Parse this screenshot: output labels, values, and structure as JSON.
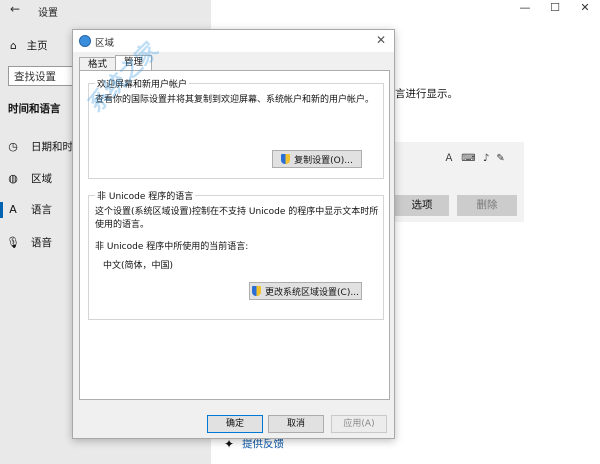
{
  "settings": {
    "title": "设置",
    "back_icon": "back-arrow-icon",
    "home_label": "主页",
    "search_placeholder": "查找设置",
    "section_heading": "时间和语言",
    "nav_items": [
      {
        "label": "日期和时间",
        "icon": "clock-calendar-icon"
      },
      {
        "label": "区域",
        "icon": "globe-icon"
      },
      {
        "label": "语言",
        "icon": "language-icon"
      },
      {
        "label": "语音",
        "icon": "microphone-icon"
      }
    ],
    "window_controls": [
      "—",
      "☐",
      "✕"
    ],
    "bg_text": "言进行显示。",
    "bg_options_button": "选项",
    "bg_delete_button": "删除",
    "feedback_link": "提供反馈"
  },
  "dialog": {
    "title": "区域",
    "tabs": [
      {
        "label": "格式",
        "active": false
      },
      {
        "label": "管理",
        "active": true
      }
    ],
    "welcome_group": {
      "label": "欢迎屏幕和新用户帐户",
      "description": "查看你的国际设置并将其复制到欢迎屏幕、系统帐户和新的用户帐户。",
      "button": "复制设置(O)..."
    },
    "unicode_group": {
      "label": "非 Unicode 程序的语言",
      "description": "这个设置(系统区域设置)控制在不支持 Unicode 的程序中显示文本时所使用的语言。",
      "current_label": "非 Unicode 程序中所使用的当前语言:",
      "current_value": "中文(简体，中国)",
      "button": "更改系统区域设置(C)..."
    },
    "buttons": {
      "ok": "确定",
      "cancel": "取消",
      "apply": "应用(A)"
    }
  },
  "watermark": "系统之家"
}
